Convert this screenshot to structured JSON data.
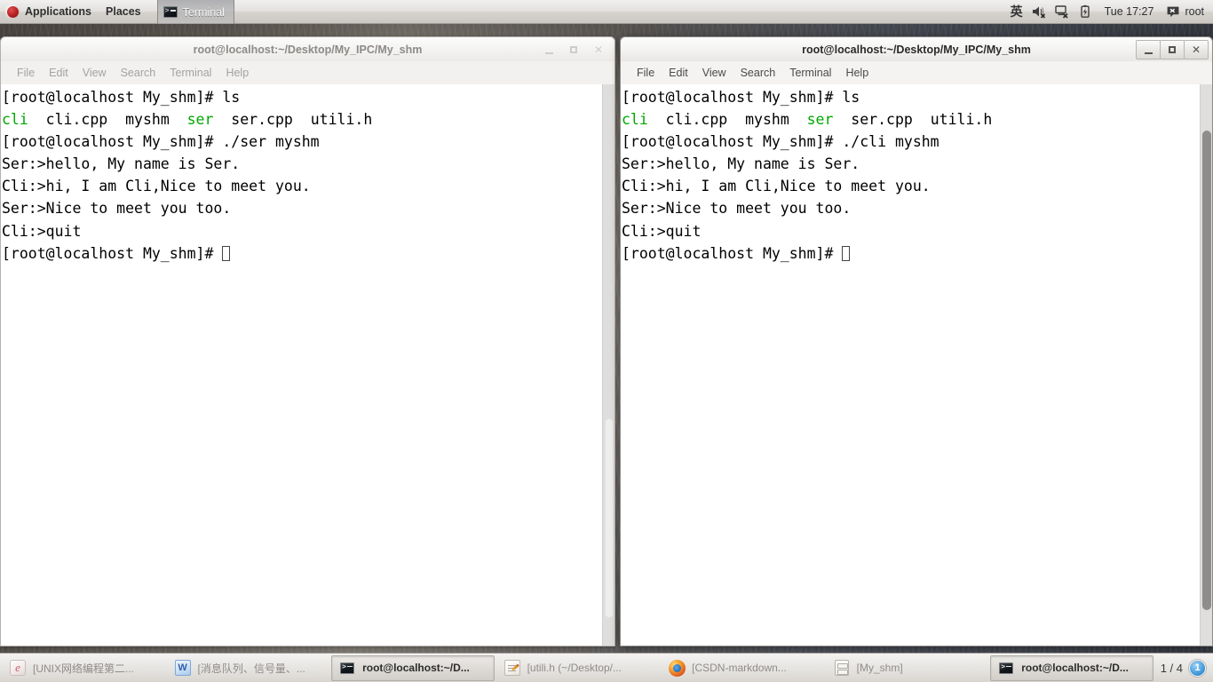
{
  "top_panel": {
    "logo_name": "fedora-logo",
    "applications_label": "Applications",
    "places_label": "Places",
    "window_item_label": "Terminal",
    "ime_label": "英",
    "clock": "Tue 17:27",
    "user_label": "root",
    "tray_icons": [
      "volume-muted-icon",
      "network-disconnected-icon",
      "battery-icon"
    ],
    "user_icon": "user-status-icon"
  },
  "windows": [
    {
      "id": "left",
      "title": "root@localhost:~/Desktop/My_IPC/My_shm",
      "active": false,
      "menus": [
        "File",
        "Edit",
        "View",
        "Search",
        "Terminal",
        "Help"
      ],
      "buttons": {
        "minimize": "_",
        "maximize": "□",
        "close": "✕"
      },
      "terminal_lines": [
        {
          "segments": [
            {
              "text": "[root@localhost My_shm]# ls",
              "color": "black"
            }
          ]
        },
        {
          "segments": [
            {
              "text": "cli",
              "color": "green"
            },
            {
              "text": "  cli.cpp  myshm  ",
              "color": "black"
            },
            {
              "text": "ser",
              "color": "green"
            },
            {
              "text": "  ser.cpp  utili.h",
              "color": "black"
            }
          ]
        },
        {
          "segments": [
            {
              "text": "[root@localhost My_shm]# ./ser myshm",
              "color": "black"
            }
          ]
        },
        {
          "segments": [
            {
              "text": "Ser:>hello, My name is Ser.",
              "color": "black"
            }
          ]
        },
        {
          "segments": [
            {
              "text": "Cli:>hi, I am Cli,Nice to meet you.",
              "color": "black"
            }
          ]
        },
        {
          "segments": [
            {
              "text": "Ser:>Nice to meet you too.",
              "color": "black"
            }
          ]
        },
        {
          "segments": [
            {
              "text": "Cli:>quit",
              "color": "black"
            }
          ]
        },
        {
          "segments": [
            {
              "text": "[root@localhost My_shm]# ",
              "color": "black"
            }
          ],
          "cursor": true
        }
      ]
    },
    {
      "id": "right",
      "title": "root@localhost:~/Desktop/My_IPC/My_shm",
      "active": true,
      "menus": [
        "File",
        "Edit",
        "View",
        "Search",
        "Terminal",
        "Help"
      ],
      "buttons": {
        "minimize": "_",
        "maximize": "□",
        "close": "✕"
      },
      "terminal_lines": [
        {
          "segments": [
            {
              "text": "[root@localhost My_shm]# ls",
              "color": "black"
            }
          ]
        },
        {
          "segments": [
            {
              "text": "cli",
              "color": "green"
            },
            {
              "text": "  cli.cpp  myshm  ",
              "color": "black"
            },
            {
              "text": "ser",
              "color": "green"
            },
            {
              "text": "  ser.cpp  utili.h",
              "color": "black"
            }
          ]
        },
        {
          "segments": [
            {
              "text": "[root@localhost My_shm]# ./cli myshm",
              "color": "black"
            }
          ]
        },
        {
          "segments": [
            {
              "text": "Ser:>hello, My name is Ser.",
              "color": "black"
            }
          ]
        },
        {
          "segments": [
            {
              "text": "Cli:>hi, I am Cli,Nice to meet you.",
              "color": "black"
            }
          ]
        },
        {
          "segments": [
            {
              "text": "Ser:>Nice to meet you too.",
              "color": "black"
            }
          ]
        },
        {
          "segments": [
            {
              "text": "Cli:>quit",
              "color": "black"
            }
          ]
        },
        {
          "segments": [
            {
              "text": "[root@localhost My_shm]# ",
              "color": "black"
            }
          ],
          "cursor": true
        }
      ]
    }
  ],
  "bottom_panel": {
    "tasks": [
      {
        "label": "[UNIX网络编程第二...",
        "icon": "ereader-icon",
        "active": false
      },
      {
        "label": "[消息队列、信号量、...",
        "icon": "word-document-icon",
        "active": false
      },
      {
        "label": "root@localhost:~/D...",
        "icon": "terminal-icon",
        "active": true
      },
      {
        "label": "[utili.h (~/Desktop/...",
        "icon": "text-editor-icon",
        "active": false
      },
      {
        "label": "[CSDN-markdown...",
        "icon": "firefox-icon",
        "active": false
      },
      {
        "label": "[My_shm]",
        "icon": "file-manager-icon",
        "active": false
      },
      {
        "label": "root@localhost:~/D...",
        "icon": "terminal-icon",
        "active": true
      }
    ],
    "workspace_label": "1 / 4",
    "notification_count": "1"
  },
  "colors": {
    "terminal_green": "#00a800",
    "terminal_text": "#000000",
    "terminal_bg": "#ffffff",
    "panel_bg": "#e7e5e2",
    "accent_blue": "#2176b8"
  }
}
